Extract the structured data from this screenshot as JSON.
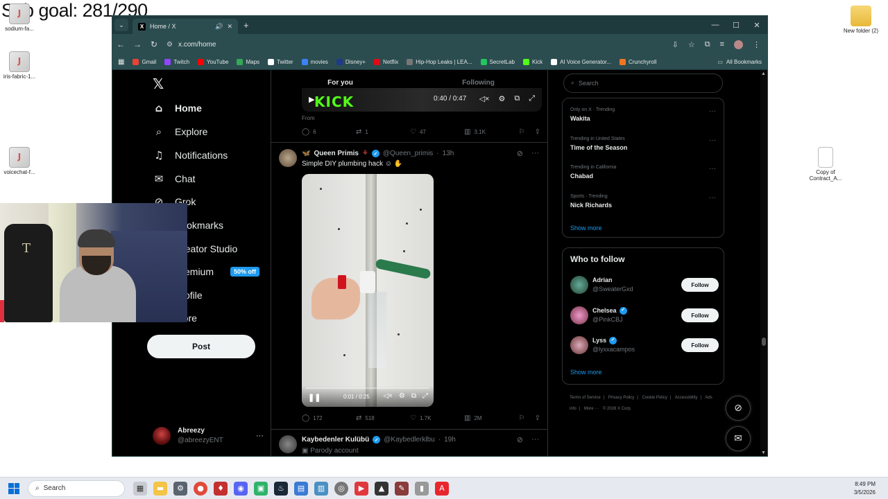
{
  "overlay": {
    "sub_goal": "Sub goal: 281/290"
  },
  "desktop": {
    "icons": [
      {
        "label": "sodium-fa..."
      },
      {
        "label": "iris-fabric-1..."
      },
      {
        "label": "voicechat-f..."
      },
      {
        "label": "New folder (2)"
      },
      {
        "label": "Copy of Contract_A..."
      }
    ]
  },
  "browser": {
    "tab": {
      "title": "Home / X",
      "favicon": "x-icon"
    },
    "url": "x.com/home",
    "bookmarks": [
      {
        "label": "Gmail",
        "color": "#ea4335"
      },
      {
        "label": "Twitch",
        "color": "#9146ff"
      },
      {
        "label": "YouTube",
        "color": "#ff0000"
      },
      {
        "label": "Maps",
        "color": "#34a853"
      },
      {
        "label": "Twitter",
        "color": "#ffffff"
      },
      {
        "label": "movies",
        "color": "#3b82f6"
      },
      {
        "label": "Disney+",
        "color": "#1f3a8a"
      },
      {
        "label": "Netflix",
        "color": "#e50914"
      },
      {
        "label": "Hip-Hop Leaks | LEA...",
        "color": "#777777"
      },
      {
        "label": "SecretLab",
        "color": "#22c55e"
      },
      {
        "label": "Kick",
        "color": "#53fc18"
      },
      {
        "label": "AI Voice Generator...",
        "color": "#ffffff"
      },
      {
        "label": "Crunchyroll",
        "color": "#f47521"
      }
    ],
    "all_bookmarks": "All Bookmarks"
  },
  "left_nav": {
    "items": [
      {
        "label": "Home",
        "icon": "home-icon"
      },
      {
        "label": "Explore",
        "icon": "search-icon"
      },
      {
        "label": "Notifications",
        "icon": "bell-icon"
      },
      {
        "label": "Chat",
        "icon": "mail-icon"
      },
      {
        "label": "Grok",
        "icon": "grok-icon"
      },
      {
        "label": "Bookmarks",
        "icon": "bookmark-icon"
      },
      {
        "label": "Creator Studio",
        "icon": "creator-icon"
      },
      {
        "label": "Premium",
        "icon": "x-premium-icon"
      },
      {
        "label": "Profile",
        "icon": "person-icon"
      },
      {
        "label": "More",
        "icon": "more-icon"
      }
    ],
    "premium_badge": "50% off",
    "post_button": "Post",
    "profile": {
      "name": "Abreezy",
      "handle": "@abreezyENT"
    }
  },
  "feed": {
    "tabs": {
      "for_you": "For you",
      "following": "Following"
    },
    "prev_post": {
      "video_time": "0:40 / 0:47",
      "from": "From",
      "stats": {
        "replies": "6",
        "reposts": "1",
        "likes": "47",
        "views": "3.1K"
      }
    },
    "post1": {
      "name": "Queen Primis",
      "handle": "@Queen_primis",
      "time": "13h",
      "text": "Simple DIY plumbing hack",
      "video_time": "0:01 / 0:25",
      "stats": {
        "replies": "172",
        "reposts": "518",
        "likes": "1.7K",
        "views": "2M"
      }
    },
    "post2": {
      "name": "Kaybedenler Kulübü",
      "handle": "@Kaybedlerklbu",
      "time": "19h",
      "subtext": "Parody account"
    }
  },
  "right": {
    "search_placeholder": "Search",
    "trends": [
      {
        "context": "Only on X · Trending",
        "name": "Wakita"
      },
      {
        "context": "Trending in United States",
        "name": "Time of the Season"
      },
      {
        "context": "Trending in California",
        "name": "Chabad"
      },
      {
        "context": "Sports · Trending",
        "name": "Nick Richards"
      }
    ],
    "show_more": "Show more",
    "who_to_follow": {
      "title": "Who to follow",
      "users": [
        {
          "name": "Adrian",
          "handle": "@SweaterGxd",
          "verified": false
        },
        {
          "name": "Chelsea",
          "handle": "@PinkCBJ",
          "verified": true
        },
        {
          "name": "Lyss",
          "handle": "@lyxxacampos",
          "verified": true
        }
      ],
      "follow_label": "Follow",
      "show_more": "Show more"
    },
    "footer": [
      "Terms of Service",
      "|",
      "Privacy Policy",
      "|",
      "Cookie Policy",
      "|",
      "Accessibility",
      "|",
      "Ads info",
      "|",
      "More ···",
      "© 2026 X Corp."
    ]
  },
  "taskbar": {
    "search": "Search",
    "time": "8:49 PM",
    "date": "3/5/2026"
  }
}
